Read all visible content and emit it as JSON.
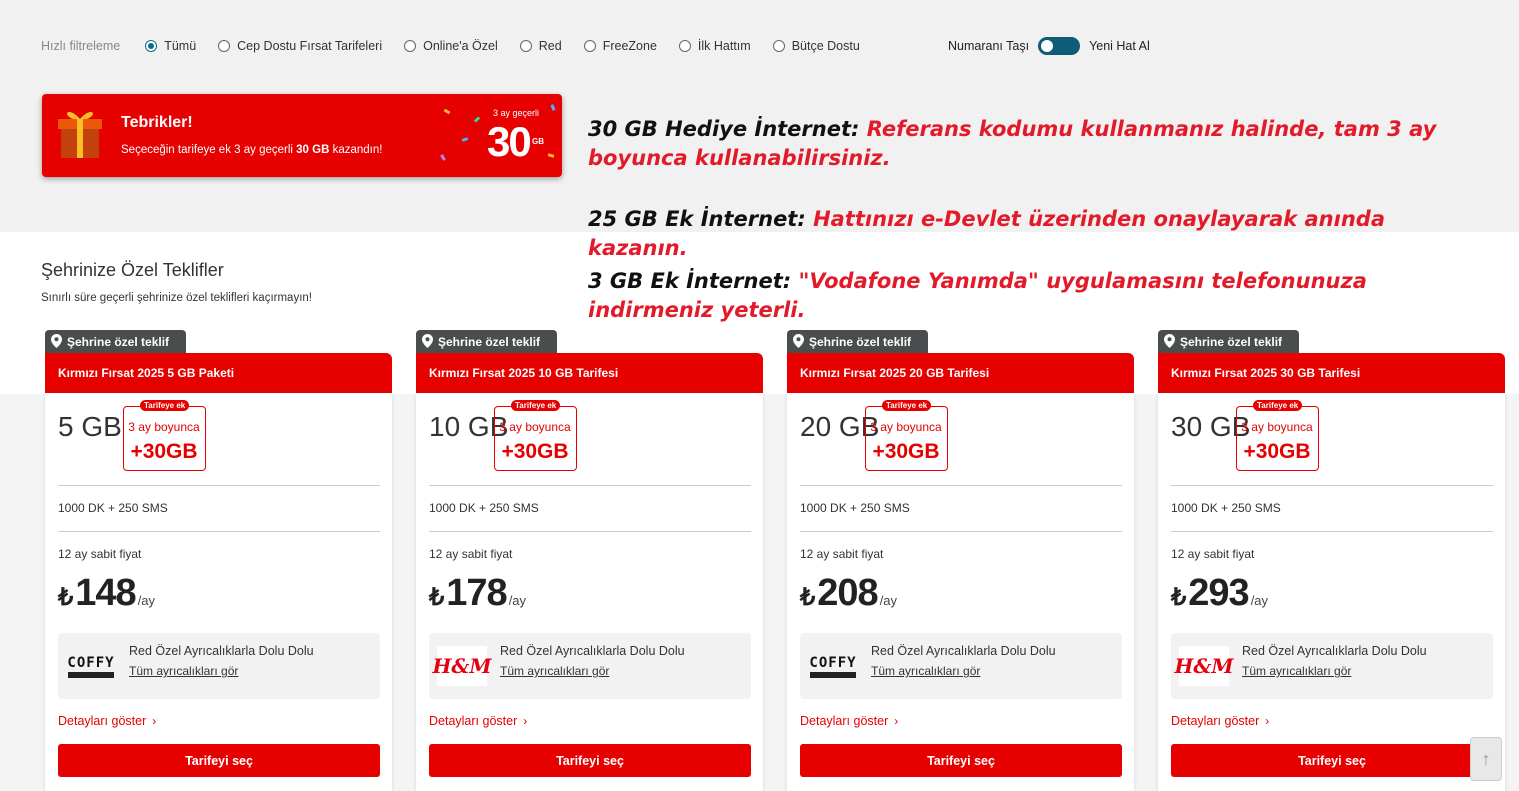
{
  "filters": {
    "label": "Hızlı filtreleme",
    "options": [
      {
        "label": "Tümü",
        "selected": true
      },
      {
        "label": "Cep Dostu Fırsat Tarifeleri",
        "selected": false
      },
      {
        "label": "Online'a Özel",
        "selected": false
      },
      {
        "label": "Red",
        "selected": false
      },
      {
        "label": "FreeZone",
        "selected": false
      },
      {
        "label": "İlk Hattım",
        "selected": false
      },
      {
        "label": "Bütçe Dostu",
        "selected": false
      }
    ]
  },
  "line_toggle": {
    "left_label": "Numaranı Taşı",
    "right_label": "Yeni Hat Al",
    "state": "left"
  },
  "promo": {
    "title": "Tebrikler!",
    "text_pre": "Seçeceğin tarifeye ek 3 ay geçerli ",
    "text_bold": "30 GB",
    "text_post": " kazandın!",
    "badge_small": "3 ay geçerli",
    "badge_big": "30",
    "badge_unit": "GB"
  },
  "notes": [
    {
      "key": "30 GB Hediye İnternet:",
      "value": "Referans kodumu kullanmanız halinde, tam 3 ay boyunca kullanabilirsiniz."
    },
    {
      "key": "25 GB Ek İnternet:",
      "value": "Hattınızı e-Devlet üzerinden onaylayarak anında kazanın."
    },
    {
      "key": "3 GB Ek İnternet:",
      "value": "\"Vodafone Yanımda\" uygulamasını telefonunuza indirmeniz yeterli."
    }
  ],
  "section": {
    "title": "Şehrinize Özel Teklifler",
    "subtitle": "Sınırlı süre geçerli şehrinize özel teklifleri kaçırmayın!"
  },
  "cards": [
    {
      "tag": "Şehrine özel teklif",
      "name": "Kırmızı Fırsat 2025 5 GB Paketi",
      "gb": "5 GB",
      "extra_label": "Tarifeye ek",
      "extra_duration": "3 ay boyunca",
      "extra_amount": "+30GB",
      "minutes_sms": "1000 DK + 250 SMS",
      "fixed_label": "12 ay sabit fiyat",
      "currency": "₺",
      "price": "148",
      "per": "/ay",
      "perk_brand": "COFFY",
      "perk_title": "Red Özel Ayrıcalıklarla Dolu Dolu",
      "perk_link": "Tüm ayrıcalıkları gör",
      "details": "Detayları göster",
      "cta": "Tarifeyi seç"
    },
    {
      "tag": "Şehrine özel teklif",
      "name": "Kırmızı Fırsat 2025 10 GB Tarifesi",
      "gb": "10 GB",
      "extra_label": "Tarifeye ek",
      "extra_duration": "3 ay boyunca",
      "extra_amount": "+30GB",
      "minutes_sms": "1000 DK + 250 SMS",
      "fixed_label": "12 ay sabit fiyat",
      "currency": "₺",
      "price": "178",
      "per": "/ay",
      "perk_brand": "H&M",
      "perk_title": "Red Özel Ayrıcalıklarla Dolu Dolu",
      "perk_link": "Tüm ayrıcalıkları gör",
      "details": "Detayları göster",
      "cta": "Tarifeyi seç"
    },
    {
      "tag": "Şehrine özel teklif",
      "name": "Kırmızı Fırsat 2025 20 GB Tarifesi",
      "gb": "20 GB",
      "extra_label": "Tarifeye ek",
      "extra_duration": "3 ay boyunca",
      "extra_amount": "+30GB",
      "minutes_sms": "1000 DK + 250 SMS",
      "fixed_label": "12 ay sabit fiyat",
      "currency": "₺",
      "price": "208",
      "per": "/ay",
      "perk_brand": "COFFY",
      "perk_title": "Red Özel Ayrıcalıklarla Dolu Dolu",
      "perk_link": "Tüm ayrıcalıkları gör",
      "details": "Detayları göster",
      "cta": "Tarifeyi seç"
    },
    {
      "tag": "Şehrine özel teklif",
      "name": "Kırmızı Fırsat 2025 30 GB Tarifesi",
      "gb": "30 GB",
      "extra_label": "Tarifeye ek",
      "extra_duration": "3 ay boyunca",
      "extra_amount": "+30GB",
      "minutes_sms": "1000 DK + 250 SMS",
      "fixed_label": "12 ay sabit fiyat",
      "currency": "₺",
      "price": "293",
      "per": "/ay",
      "perk_brand": "H&M",
      "perk_title": "Red Özel Ayrıcalıklarla Dolu Dolu",
      "perk_link": "Tüm ayrıcalıkları gör",
      "details": "Detayları göster",
      "cta": "Tarifeyi seç"
    }
  ],
  "colors": {
    "brand_red": "#e60000",
    "note_red": "#e21b2b",
    "toggle": "#0d5d78",
    "tag_gray": "#4a4d4e"
  }
}
